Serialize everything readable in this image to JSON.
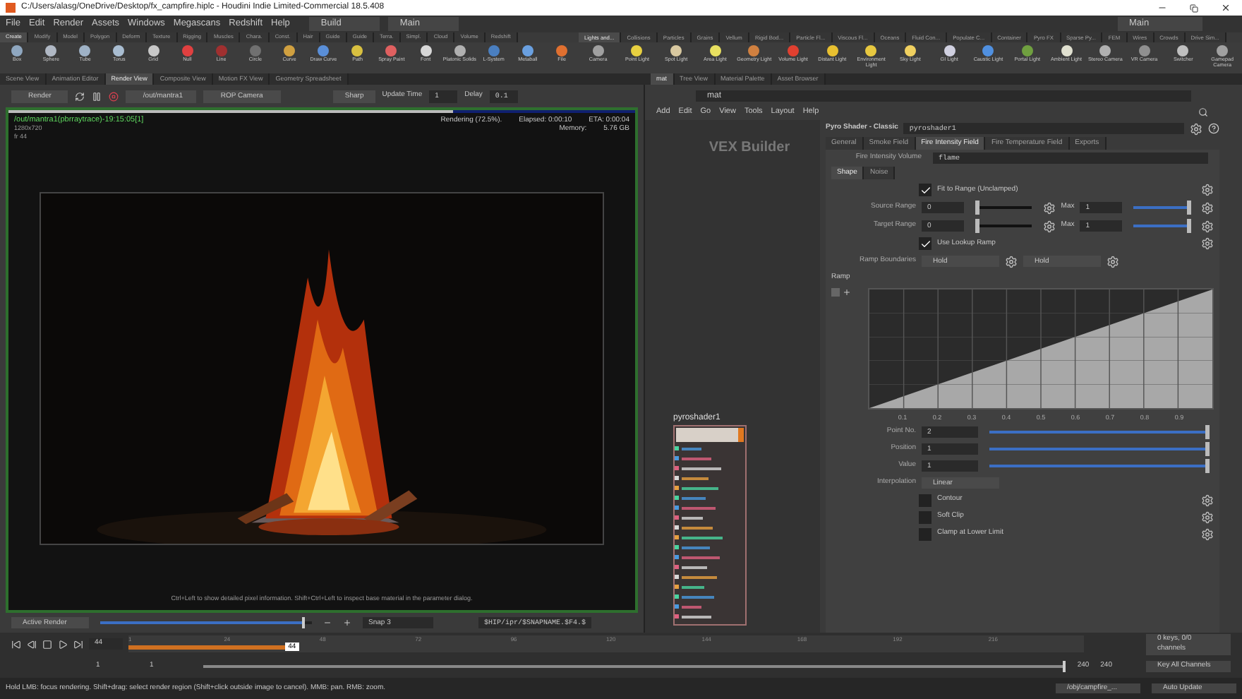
{
  "window": {
    "title": "C:/Users/alasg/OneDrive/Desktop/fx_campfire.hiplc - Houdini Indie Limited-Commercial 18.5.408"
  },
  "menu": [
    "File",
    "Edit",
    "Render",
    "Assets",
    "Windows",
    "Megascans",
    "Redshift",
    "Help"
  ],
  "desktop": "Build",
  "workspace": "Main",
  "workspace_right": "Main",
  "shelf_tabs_left": [
    {
      "label": "Create",
      "selected": true
    },
    {
      "label": "Modify",
      "selected": false
    },
    {
      "label": "Model",
      "selected": false
    },
    {
      "label": "Polygon",
      "selected": false
    },
    {
      "label": "Deform",
      "selected": false
    },
    {
      "label": "Texture",
      "selected": false
    },
    {
      "label": "Rigging",
      "selected": false
    },
    {
      "label": "Muscles",
      "selected": false
    },
    {
      "label": "Chara.",
      "selected": false
    },
    {
      "label": "Const.",
      "selected": false
    },
    {
      "label": "Hair",
      "selected": false
    },
    {
      "label": "Guide",
      "selected": false
    },
    {
      "label": "Guide",
      "selected": false
    },
    {
      "label": "Terra.",
      "selected": false
    },
    {
      "label": "Simpl.",
      "selected": false
    },
    {
      "label": "Cloud",
      "selected": false
    },
    {
      "label": "Volume",
      "selected": false
    },
    {
      "label": "Redshift",
      "selected": false
    }
  ],
  "shelf_tabs_right": [
    {
      "label": "Lights and...",
      "selected": true
    },
    {
      "label": "Collisions",
      "selected": false
    },
    {
      "label": "Particles",
      "selected": false
    },
    {
      "label": "Grains",
      "selected": false
    },
    {
      "label": "Vellum",
      "selected": false
    },
    {
      "label": "Rigid Bod...",
      "selected": false
    },
    {
      "label": "Particle Fl...",
      "selected": false
    },
    {
      "label": "Viscous Fl...",
      "selected": false
    },
    {
      "label": "Oceans",
      "selected": false
    },
    {
      "label": "Fluid Con...",
      "selected": false
    },
    {
      "label": "Populate C...",
      "selected": false
    },
    {
      "label": "Container",
      "selected": false
    },
    {
      "label": "Pyro FX",
      "selected": false
    },
    {
      "label": "Sparse Py...",
      "selected": false
    },
    {
      "label": "FEM",
      "selected": false
    },
    {
      "label": "Wires",
      "selected": false
    },
    {
      "label": "Crowds",
      "selected": false
    },
    {
      "label": "Drive Sim...",
      "selected": false
    }
  ],
  "tools_left": [
    {
      "label": "Box",
      "color": "#8fa7c0"
    },
    {
      "label": "Sphere",
      "color": "#b0b8c4"
    },
    {
      "label": "Tube",
      "color": "#9fb2c6"
    },
    {
      "label": "Torus",
      "color": "#a9bdd1"
    },
    {
      "label": "Grid",
      "color": "#c8c8c8"
    },
    {
      "label": "Null",
      "color": "#e04040"
    },
    {
      "label": "Line",
      "color": "#a03030"
    },
    {
      "label": "Circle",
      "color": "#707070"
    },
    {
      "label": "Curve",
      "color": "#d0a040"
    },
    {
      "label": "Draw Curve",
      "color": "#5a8fd8"
    },
    {
      "label": "Path",
      "color": "#d8c040"
    },
    {
      "label": "Spray Paint",
      "color": "#e06060"
    },
    {
      "label": "Font",
      "color": "#d8d8d8"
    },
    {
      "label": "Platonic Solids",
      "color": "#b0b0b0"
    },
    {
      "label": "L-System",
      "color": "#4a7fc0"
    },
    {
      "label": "Metaball",
      "color": "#6aa0e0"
    },
    {
      "label": "File",
      "color": "#e07030"
    }
  ],
  "tools_right": [
    {
      "label": "Camera",
      "color": "#a0a0a0"
    },
    {
      "label": "Point Light",
      "color": "#e8d040"
    },
    {
      "label": "Spot Light",
      "color": "#d8c8a0"
    },
    {
      "label": "Area Light",
      "color": "#e8e060"
    },
    {
      "label": "Geometry Light",
      "color": "#d08040"
    },
    {
      "label": "Volume Light",
      "color": "#e04030"
    },
    {
      "label": "Distant Light",
      "color": "#e8c030"
    },
    {
      "label": "Environment Light",
      "color": "#e8c840"
    },
    {
      "label": "Sky Light",
      "color": "#f0d060"
    },
    {
      "label": "GI Light",
      "color": "#d0d0e0"
    },
    {
      "label": "Caustic Light",
      "color": "#5090e0"
    },
    {
      "label": "Portal Light",
      "color": "#70a040"
    },
    {
      "label": "Ambient Light",
      "color": "#e0e0d0"
    },
    {
      "label": "Stereo Camera",
      "color": "#b0b0b0"
    },
    {
      "label": "VR Camera",
      "color": "#909090"
    },
    {
      "label": "Switcher",
      "color": "#c0c0c0"
    },
    {
      "label": "Gamepad Camera",
      "color": "#a0a0a0"
    }
  ],
  "pane_tabs_left": [
    {
      "label": "Scene View",
      "selected": false
    },
    {
      "label": "Animation Editor",
      "selected": false
    },
    {
      "label": "Render View",
      "selected": true
    },
    {
      "label": "Composite View",
      "selected": false
    },
    {
      "label": "Motion FX View",
      "selected": false
    },
    {
      "label": "Geometry Spreadsheet",
      "selected": false
    }
  ],
  "pane_tabs_right": [
    {
      "label": "mat",
      "selected": true
    },
    {
      "label": "Tree View",
      "selected": false
    },
    {
      "label": "Material Palette",
      "selected": false
    },
    {
      "label": "Asset Browser",
      "selected": false
    }
  ],
  "render_toolbar": {
    "render_button": "Render",
    "rop": "/out/mantra1",
    "camera": "ROP Camera",
    "quality": "Sharp",
    "update_time_label": "Update Time",
    "update_time": "1",
    "delay_label": "Delay",
    "delay": "0.1"
  },
  "render_view": {
    "progress": {
      "level": 0.71
    },
    "title": "/out/mantra1(pbrraytrace)-19:15:05[1]",
    "resolution": "1280x720",
    "frame": "fr 44",
    "status": "Rendering (72.5%).",
    "elapsed": "Elapsed: 0:00:10",
    "eta": "ETA: 0:00:04",
    "memory_label": "Memory:",
    "memory": "5.76 GB",
    "hint": "Ctrl+Left to show detailed pixel information. Shift+Ctrl+Left to inspect base material in the parameter dialog."
  },
  "render_bottom": {
    "active_render": "Active Render",
    "zoom": {
      "level": 0.95
    },
    "snap": "Snap 3",
    "path": "$HIP/ipr/$SNAPNAME.$F4.$"
  },
  "network": {
    "path": "mat",
    "menu": [
      "Add",
      "Edit",
      "Go",
      "View",
      "Tools",
      "Layout",
      "Help"
    ],
    "context": "VEX Builder",
    "node": "pyroshader1"
  },
  "params": {
    "type": "Pyro Shader - Classic",
    "name": "pyroshader1",
    "tabs": [
      {
        "label": "General",
        "selected": false
      },
      {
        "label": "Smoke Field",
        "selected": false
      },
      {
        "label": "Fire Intensity Field",
        "selected": true
      },
      {
        "label": "Fire Temperature Field",
        "selected": false
      },
      {
        "label": "Exports",
        "selected": false
      }
    ],
    "volume_label": "Fire Intensity Volume",
    "volume": "flame",
    "subtabs": [
      {
        "label": "Shape",
        "selected": true
      },
      {
        "label": "Noise",
        "selected": false
      }
    ],
    "fit_to_range": {
      "label": "Fit to Range (Unclamped)",
      "checked": true
    },
    "ranges": [
      {
        "label": "Source Range",
        "min": "0",
        "max_label": "Max",
        "max": "1",
        "level": 1
      },
      {
        "label": "Target Range",
        "min": "0",
        "max_label": "Max",
        "max": "1",
        "level": 1
      }
    ],
    "use_lookup_ramp": {
      "label": "Use Lookup Ramp",
      "checked": true
    },
    "ramp_boundaries": {
      "label": "Ramp Boundaries",
      "left": "Hold",
      "right": "Hold"
    },
    "ramp": {
      "label": "Ramp",
      "xticks": [
        "0.1",
        "0.2",
        "0.3",
        "0.4",
        "0.5",
        "0.6",
        "0.7",
        "0.8",
        "0.9"
      ]
    },
    "point_fields": [
      {
        "label": "Point No.",
        "value": "2",
        "level": 1
      },
      {
        "label": "Position",
        "value": "1",
        "level": 1
      },
      {
        "label": "Value",
        "value": "1",
        "level": 1
      }
    ],
    "interpolation": {
      "label": "Interpolation",
      "value": "Linear"
    },
    "toggles": [
      {
        "label": "Contour",
        "checked": false
      },
      {
        "label": "Soft Clip",
        "checked": false
      },
      {
        "label": "Clamp at Lower Limit",
        "checked": false
      }
    ]
  },
  "timeline": {
    "frame": "44",
    "playhead": "44",
    "range": {
      "level": 1
    },
    "ticks": [
      "1",
      "24",
      "48",
      "72",
      "96",
      "120",
      "144",
      "168",
      "192",
      "216"
    ],
    "cache": {
      "level": 0.17
    },
    "start": "1",
    "range_start": "1",
    "range_end": "240",
    "end": "240",
    "keys": "0 keys, 0/0 channels",
    "key_all": "Key All Channels"
  },
  "status_bar": {
    "message": "Hold LMB: focus rendering. Shift+drag: select render region (Shift+click outside image to cancel). MMB: pan. RMB: zoom.",
    "path": "/obj/campfire_...",
    "update": "Auto Update"
  }
}
